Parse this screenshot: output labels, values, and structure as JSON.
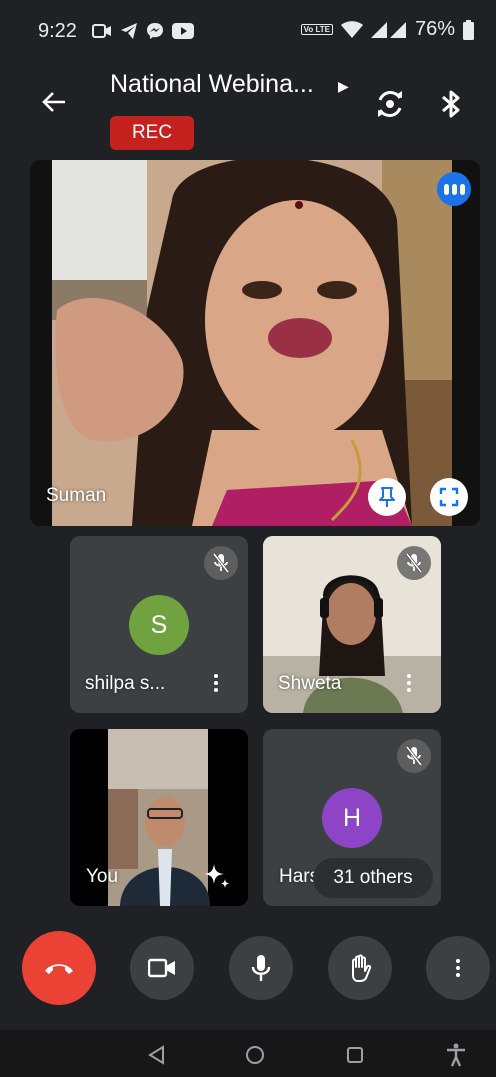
{
  "status_bar": {
    "time": "9:22",
    "network_label": "Vo LTE",
    "battery": "76%",
    "icons": [
      "video-call-icon",
      "telegram-icon",
      "messenger-icon",
      "youtube-icon",
      "volte-icon",
      "wifi-icon",
      "signal-icon",
      "battery-icon"
    ]
  },
  "header": {
    "title": "National Webina...",
    "recording_label": "REC"
  },
  "main_tile": {
    "speaker_name": "Suman"
  },
  "participants": [
    {
      "name": "shilpa s...",
      "initial": "S",
      "muted": true
    },
    {
      "name": "Shweta",
      "muted": true
    },
    {
      "name": "You"
    },
    {
      "name": "Harsh",
      "initial": "H",
      "muted": true
    }
  ],
  "others_label": "31 others",
  "colors": {
    "background": "#202124",
    "end_call": "#ea4335",
    "rec": "#c5221f",
    "speaking": "#1a73e8",
    "avatar_s": "#70a340",
    "avatar_h": "#8e44c6"
  }
}
